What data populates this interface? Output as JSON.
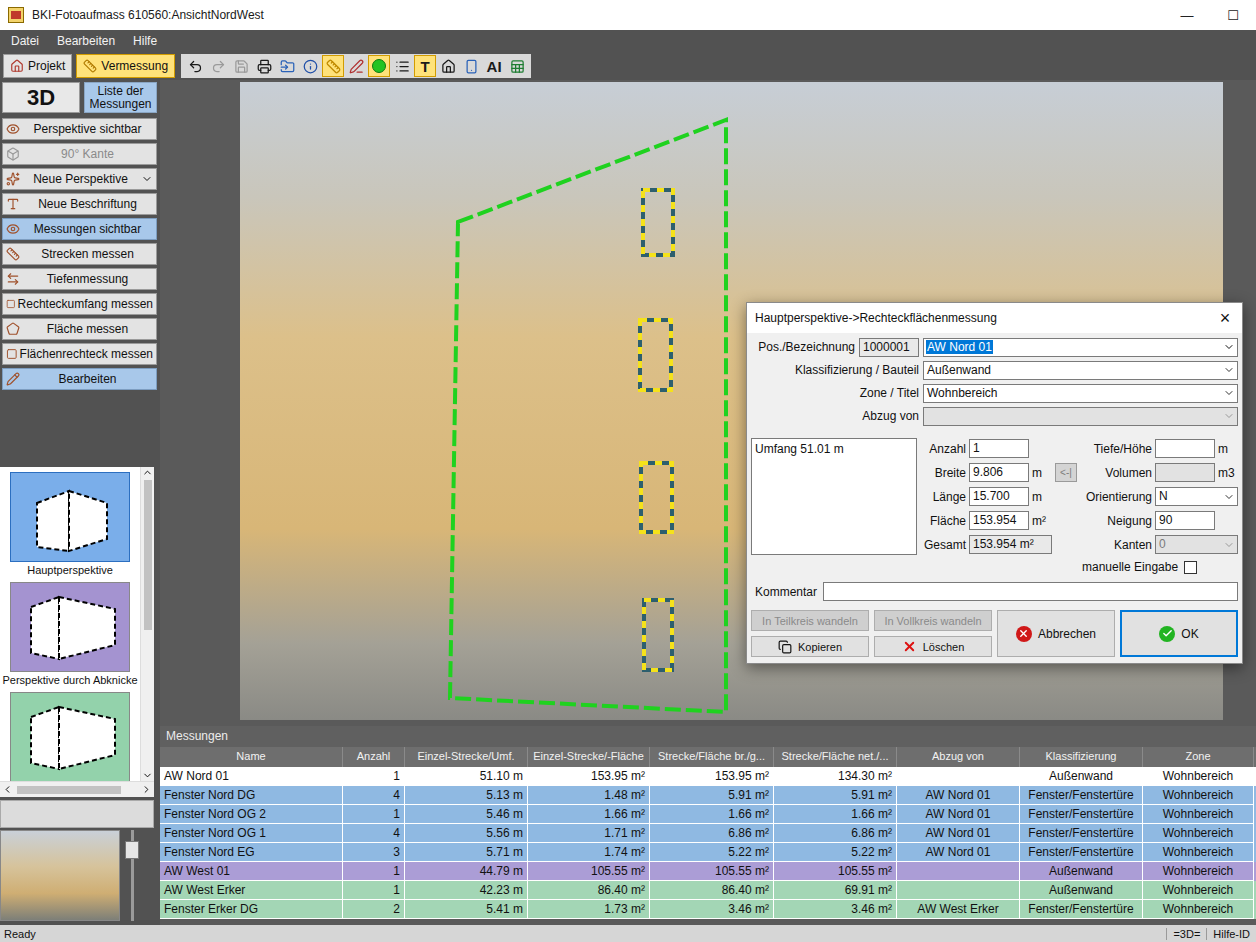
{
  "window": {
    "title": "BKI-Fotoaufmass 610560:AnsichtNordWest",
    "controls": [
      "—",
      "☐"
    ]
  },
  "menu": [
    "Datei",
    "Bearbeiten",
    "Hilfe"
  ],
  "modes": [
    {
      "label": "Projekt",
      "selected": false
    },
    {
      "label": "Vermessung",
      "selected": true
    }
  ],
  "tools": [
    {
      "kind": "undo",
      "label": "",
      "selected": false,
      "disabled": false
    },
    {
      "kind": "redo",
      "label": "",
      "selected": false,
      "disabled": true
    },
    {
      "kind": "save",
      "label": "",
      "selected": false,
      "disabled": true
    },
    {
      "kind": "print",
      "label": "",
      "selected": false,
      "disabled": false
    },
    {
      "kind": "import",
      "label": "",
      "selected": false,
      "disabled": false
    },
    {
      "kind": "info",
      "label": "",
      "selected": false,
      "disabled": false
    },
    {
      "kind": "measure",
      "label": "",
      "selected": true,
      "disabled": false
    },
    {
      "kind": "line",
      "label": "",
      "selected": false,
      "disabled": false
    },
    {
      "kind": "dot",
      "label": "",
      "selected": true,
      "disabled": false
    },
    {
      "kind": "layers",
      "label": "",
      "selected": false,
      "disabled": false
    },
    {
      "kind": "text",
      "label": "T",
      "selected": true,
      "disabled": false
    },
    {
      "kind": "house",
      "label": "",
      "selected": false,
      "disabled": false
    },
    {
      "kind": "panel",
      "label": "",
      "selected": false,
      "disabled": false
    },
    {
      "kind": "text",
      "label": "AI",
      "selected": false,
      "disabled": false
    },
    {
      "kind": "excel",
      "label": "",
      "selected": false,
      "disabled": false
    }
  ],
  "sidebar": {
    "view_button": {
      "label": "3D"
    },
    "list_button": {
      "label": "Liste der Messungen",
      "selected": true
    },
    "items": [
      {
        "label": "Perspektive sichtbar",
        "selected": false,
        "disabled": false,
        "dropdown": false
      },
      {
        "label": "90° Kante",
        "selected": false,
        "disabled": true,
        "dropdown": false
      },
      {
        "label": "Neue Perspektive",
        "selected": false,
        "disabled": false,
        "dropdown": true
      },
      {
        "label": "Neue Beschriftung",
        "selected": false,
        "disabled": false,
        "dropdown": false
      },
      {
        "label": "Messungen sichtbar",
        "selected": true,
        "disabled": false,
        "dropdown": false
      },
      {
        "label": "Strecken messen",
        "selected": false,
        "disabled": false,
        "dropdown": false
      },
      {
        "label": "Tiefenmessung",
        "selected": false,
        "disabled": false,
        "dropdown": false
      },
      {
        "label": "Rechteckumfang messen",
        "selected": false,
        "disabled": false,
        "dropdown": false
      },
      {
        "label": "Fläche messen",
        "selected": false,
        "disabled": false,
        "dropdown": false
      },
      {
        "label": "Flächenrechteck messen",
        "selected": false,
        "disabled": false,
        "dropdown": false
      },
      {
        "label": "Bearbeiten",
        "selected": true,
        "disabled": false,
        "dropdown": false
      }
    ]
  },
  "perspectives": [
    {
      "label": "Hauptperspektive",
      "selected": true,
      "color": "#7aaeea"
    },
    {
      "label": "Perspektive durch Abknicke",
      "selected": false,
      "color": "#a493d0"
    },
    {
      "label": "",
      "selected": false,
      "color": "#93d2ab"
    }
  ],
  "preview": {
    "level": 0.85
  },
  "dialog": {
    "title": "Hauptperspektive->Rechteckflächenmessung",
    "close": "×",
    "pos": {
      "label": "Pos./Bezeichnung",
      "number": "1000001",
      "value": "AW Nord 01",
      "selected": true
    },
    "combos": [
      {
        "label": "Klassifizierung / Bauteil",
        "value": "Außenwand",
        "disabled": false
      },
      {
        "label": "Zone / Titel",
        "value": "Wohnbereich",
        "disabled": false
      },
      {
        "label": "Abzug von",
        "value": "",
        "disabled": true
      }
    ],
    "summary": "Umfang 51.01 m",
    "dimensions": [
      {
        "label": "Anzahl",
        "value": "1",
        "unit": "",
        "readonly": false,
        "action": "",
        "action_disabled": false
      },
      {
        "label": "Breite",
        "value": "9.806",
        "unit": "m",
        "readonly": false,
        "action": "<-|",
        "action_disabled": true
      },
      {
        "label": "Länge",
        "value": "15.700",
        "unit": "m",
        "readonly": false,
        "action": "",
        "action_disabled": false
      },
      {
        "label": "Fläche",
        "value": "153.954",
        "unit": "m²",
        "readonly": false,
        "action": "",
        "action_disabled": false
      },
      {
        "label": "Gesamt",
        "value": "153.954 m²",
        "unit": "",
        "readonly": true,
        "action": "",
        "action_disabled": false
      }
    ],
    "properties": [
      {
        "label": "Tiefe/Höhe",
        "value": "",
        "unit": "m",
        "kind": "input",
        "disabled": false
      },
      {
        "label": "Volumen",
        "value": "",
        "unit": "m3",
        "kind": "input",
        "disabled": true
      },
      {
        "label": "Orientierung",
        "value": "N",
        "unit": "",
        "kind": "combo",
        "disabled": false
      },
      {
        "label": "Neigung",
        "value": "90",
        "unit": "",
        "kind": "input",
        "disabled": false
      },
      {
        "label": "Kanten",
        "value": "0",
        "unit": "",
        "kind": "combo",
        "disabled": true
      }
    ],
    "manual": {
      "label": "manuelle Eingabe",
      "checked": false
    },
    "comment": {
      "label": "Kommentar",
      "value": ""
    },
    "buttons": [
      {
        "label": "In Teilkreis wandeln",
        "kind": "small",
        "disabled": true,
        "default": false
      },
      {
        "label": "In Vollkreis wandeln",
        "kind": "small",
        "disabled": true,
        "default": false
      },
      {
        "label": "Kopieren",
        "kind": "small",
        "disabled": false,
        "default": false
      },
      {
        "label": "Löschen",
        "kind": "small",
        "disabled": false,
        "default": false
      },
      {
        "label": "Abbrechen",
        "kind": "large",
        "disabled": false,
        "default": false
      },
      {
        "label": "OK",
        "kind": "large",
        "disabled": false,
        "default": true
      }
    ]
  },
  "table": {
    "title": "Messungen",
    "columns": [
      "Name",
      "Anzahl",
      "Einzel-Strecke/Umf.",
      "Einzel-Strecke/-Fläche",
      "Strecke/Fläche br./g...",
      "Strecke/Fläche net./...",
      "Abzug von",
      "Klassifizierung",
      "Zone"
    ],
    "rows": [
      {
        "cells": [
          "AW Nord 01",
          "1",
          "51.10 m",
          "153.95 m²",
          "153.95 m²",
          "134.30 m²",
          "",
          "Außenwand",
          "Wohnbereich"
        ],
        "color": "#ffffff"
      },
      {
        "cells": [
          "Fenster Nord DG",
          "4",
          "5.13 m",
          "1.48 m²",
          "5.91 m²",
          "5.91 m²",
          "AW Nord 01",
          "Fenster/Fenstertüre",
          "Wohnbereich"
        ],
        "color": "#8fb9e2"
      },
      {
        "cells": [
          "Fenster Nord OG 2",
          "1",
          "5.46 m",
          "1.66 m²",
          "1.66 m²",
          "1.66 m²",
          "AW Nord 01",
          "Fenster/Fenstertüre",
          "Wohnbereich"
        ],
        "color": "#8fb9e2"
      },
      {
        "cells": [
          "Fenster Nord OG 1",
          "4",
          "5.56 m",
          "1.71 m²",
          "6.86 m²",
          "6.86 m²",
          "AW Nord 01",
          "Fenster/Fenstertüre",
          "Wohnbereich"
        ],
        "color": "#8fb9e2"
      },
      {
        "cells": [
          "Fenster Nord EG",
          "3",
          "5.71 m",
          "1.74 m²",
          "5.22 m²",
          "5.22 m²",
          "AW Nord 01",
          "Fenster/Fenstertüre",
          "Wohnbereich"
        ],
        "color": "#8fb9e2"
      },
      {
        "cells": [
          "AW West 01",
          "1",
          "44.79 m",
          "105.55 m²",
          "105.55 m²",
          "105.55 m²",
          "",
          "Außenwand",
          "Wohnbereich"
        ],
        "color": "#ab9dd6"
      },
      {
        "cells": [
          "AW West Erker",
          "1",
          "42.23 m",
          "86.40 m²",
          "86.40 m²",
          "69.91 m²",
          "",
          "Außenwand",
          "Wohnbereich"
        ],
        "color": "#a3d6b5"
      },
      {
        "cells": [
          "Fenster Erker DG",
          "2",
          "5.41 m",
          "1.73 m²",
          "3.46 m²",
          "3.46 m²",
          "AW West Erker",
          "Fenster/Fenstertüre",
          "Wohnbereich"
        ],
        "color": "#a3d6b5"
      }
    ]
  },
  "status_bar": {
    "left": "Ready",
    "right": [
      "=3D=",
      "Hilfe-ID"
    ]
  }
}
